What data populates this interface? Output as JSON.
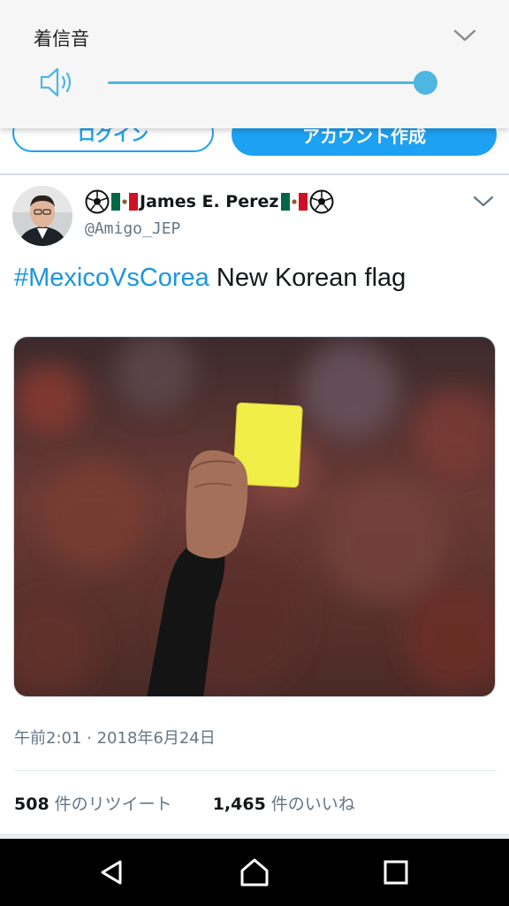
{
  "volume": {
    "title": "着信音",
    "level_percent": 100,
    "accent_color": "#4db6e2",
    "icons": {
      "speaker": "speaker-icon",
      "collapse": "chevron-down-icon"
    }
  },
  "header": {
    "login_label": "ログイン",
    "signup_label": "アカウント作成",
    "brand_color": "#1da1f2"
  },
  "tweet": {
    "display_name": "James E. Perez",
    "name_emojis": [
      "soccer-ball-icon",
      "mexico-flag-icon"
    ],
    "username": "@Amigo_JEP",
    "hashtag": "#MexicoVsCorea",
    "text": " New Korean flag",
    "media_icon": "yellow-card-photo",
    "timestamp": "午前2:01 · 2018年6月24日",
    "retweets": {
      "count": "508",
      "label": "件のリツイート"
    },
    "likes": {
      "count": "1,465",
      "label": "件のいいね"
    }
  },
  "navbar": {
    "icons": [
      "back-icon",
      "home-icon",
      "recents-icon"
    ]
  }
}
